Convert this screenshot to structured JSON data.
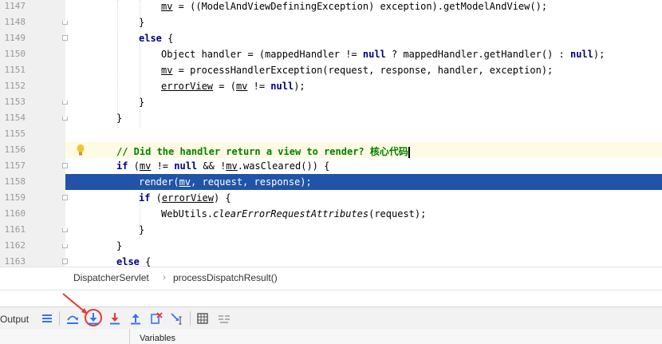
{
  "editor": {
    "lines": [
      {
        "num": "1147",
        "code": "mv = ((ModelAndViewDefiningException) exception).getModelAndView();"
      },
      {
        "num": "1148",
        "code": "}"
      },
      {
        "num": "1149",
        "code": "else {"
      },
      {
        "num": "1150",
        "code": "Object handler = (mappedHandler != null ? mappedHandler.getHandler() : null);"
      },
      {
        "num": "1151",
        "code": "mv = processHandlerException(request, response, handler, exception);"
      },
      {
        "num": "1152",
        "code": "errorView = (mv != null);"
      },
      {
        "num": "1153",
        "code": "}"
      },
      {
        "num": "1154",
        "code": "}"
      },
      {
        "num": "1155",
        "code": ""
      },
      {
        "num": "1156",
        "code": "// Did the handler return a view to render? 核心代码"
      },
      {
        "num": "1157",
        "code": "if (mv != null && !mv.wasCleared()) {"
      },
      {
        "num": "1158",
        "code": "render(mv, request, response);"
      },
      {
        "num": "1159",
        "code": "if (errorView) {"
      },
      {
        "num": "1160",
        "code": "WebUtils.clearErrorRequestAttributes(request);"
      },
      {
        "num": "1161",
        "code": "}"
      },
      {
        "num": "1162",
        "code": "}"
      },
      {
        "num": "1163",
        "code": "else {"
      }
    ],
    "highlighted_line": "1158",
    "caret_line": "1156",
    "intention_icon": "lightbulb-icon"
  },
  "breadcrumb": {
    "items": [
      "DispatcherServlet",
      "processDispatchResult()"
    ],
    "separator": "›"
  },
  "debug_toolbar": {
    "output_label": "Output",
    "buttons": [
      {
        "icon": "show-execution-point-icon"
      },
      {
        "icon": "step-over-icon"
      },
      {
        "icon": "step-into-icon"
      },
      {
        "icon": "force-step-into-icon"
      },
      {
        "icon": "step-out-icon"
      },
      {
        "icon": "drop-frame-icon"
      },
      {
        "icon": "run-to-cursor-icon"
      },
      {
        "icon": "evaluate-expression-icon"
      },
      {
        "icon": "trace-current-stream-icon"
      }
    ],
    "circled_button": "step-into-icon"
  },
  "variables_panel": {
    "title": "Variables"
  },
  "colors": {
    "exec_line": "#2154a6",
    "caret_line": "#fffae3",
    "keyword": "#000080",
    "comment": "#008000",
    "annotation_red": "#e53935"
  }
}
